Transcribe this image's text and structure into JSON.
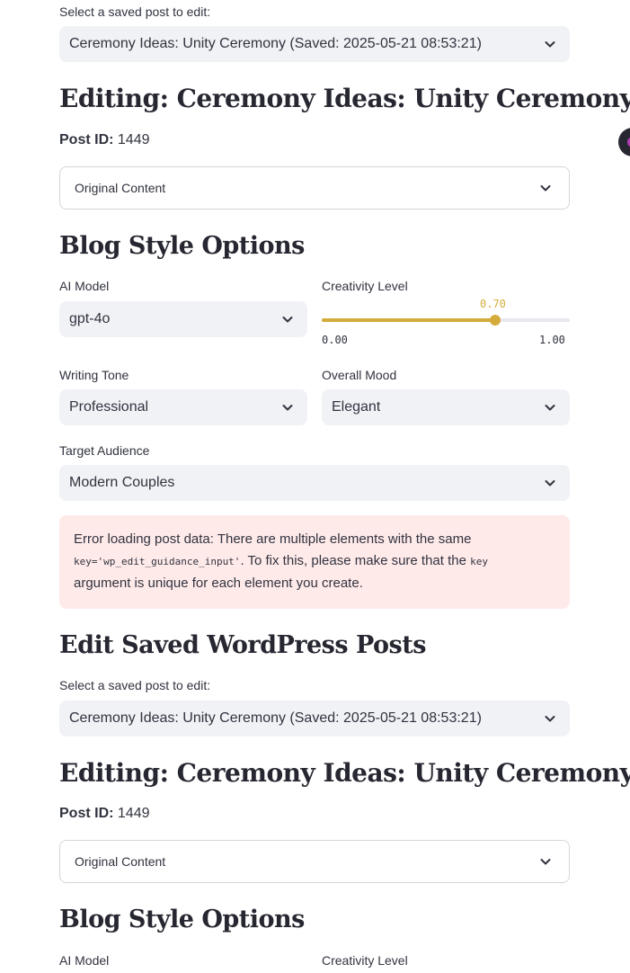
{
  "sections": [
    {
      "select_label": "Select a saved post to edit:",
      "selected_post": "Ceremony Ideas: Unity Ceremony (Saved: 2025-05-21 08:53:21)",
      "editing_title": "Editing: Ceremony Ideas: Unity Ceremony",
      "post_id_label": "Post ID:",
      "post_id_value": "1449",
      "expander_label": "Original Content",
      "style_heading": "Blog Style Options",
      "ai_model_label": "AI Model",
      "ai_model_value": "gpt-4o",
      "creativity_label": "Creativity Level",
      "creativity_value": "0.70",
      "creativity_min": "0.00",
      "creativity_max": "1.00",
      "creativity_fraction": 0.7,
      "tone_label": "Writing Tone",
      "tone_value": "Professional",
      "mood_label": "Overall Mood",
      "mood_value": "Elegant",
      "audience_label": "Target Audience",
      "audience_value": "Modern Couples"
    },
    {
      "page_heading": "Edit Saved WordPress Posts",
      "select_label": "Select a saved post to edit:",
      "selected_post": "Ceremony Ideas: Unity Ceremony (Saved: 2025-05-21 08:53:21)",
      "editing_title": "Editing: Ceremony Ideas: Unity Ceremony",
      "post_id_label": "Post ID:",
      "post_id_value": "1449",
      "expander_label": "Original Content",
      "style_heading": "Blog Style Options",
      "ai_model_label": "AI Model",
      "creativity_label": "Creativity Level"
    }
  ],
  "error": {
    "text_1": "Error loading post data: There are multiple elements with the same",
    "code_1": "key='wp_edit_guidance_input'",
    "text_2": ". To fix this, please make sure that the ",
    "code_2": "key",
    "text_3": "argument is unique for each element you create."
  },
  "colors": {
    "accent": "#d4ac3b",
    "error_bg": "#ffeaea",
    "select_bg": "#f0f2f6"
  }
}
